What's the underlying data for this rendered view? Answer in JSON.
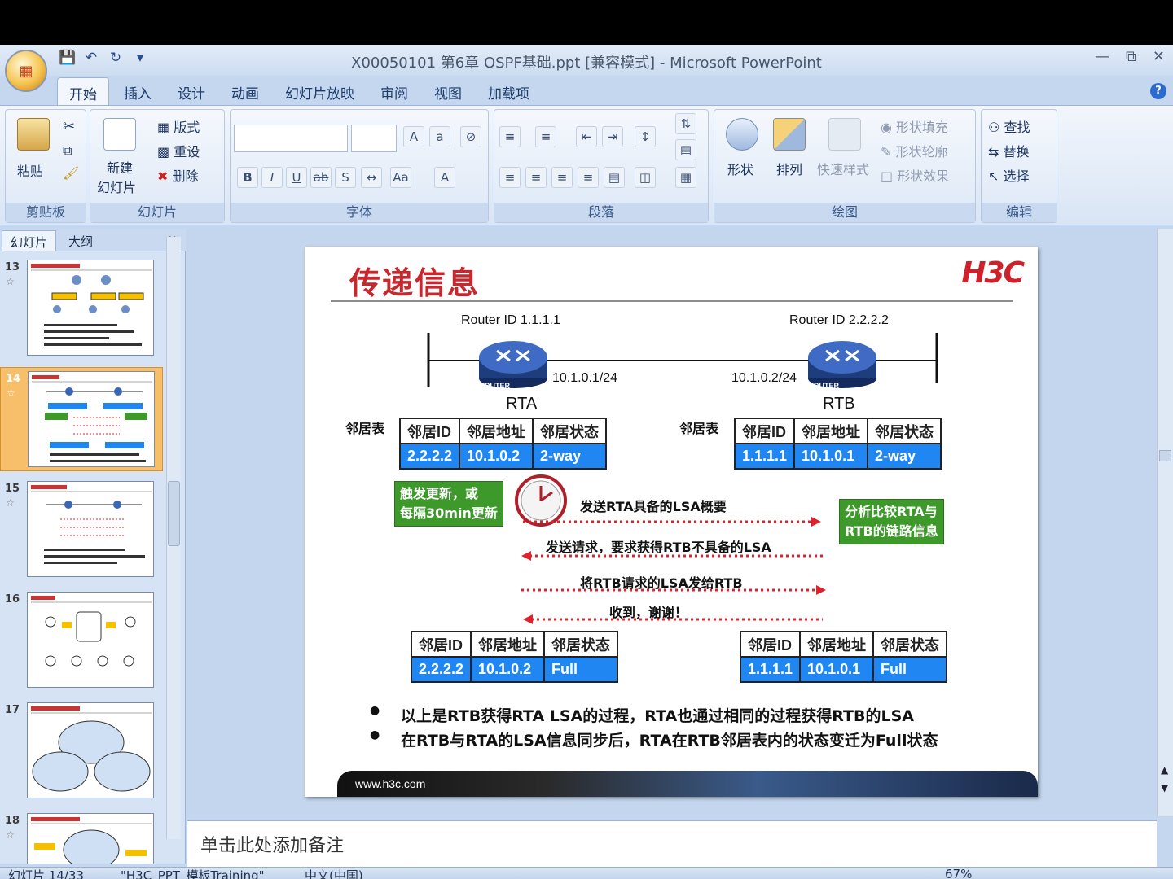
{
  "window": {
    "title": "X00050101 第6章 OSPF基础.ppt [兼容模式] - Microsoft PowerPoint"
  },
  "ribbon": {
    "tabs": [
      "开始",
      "插入",
      "设计",
      "动画",
      "幻灯片放映",
      "审阅",
      "视图",
      "加载项"
    ],
    "clipboard": {
      "paste": "粘贴",
      "label": "剪贴板"
    },
    "slides": {
      "new_slide_1": "新建",
      "new_slide_2": "幻灯片",
      "layout": "版式",
      "reset": "重设",
      "delete": "删除",
      "label": "幻灯片"
    },
    "font": {
      "label": "字体"
    },
    "paragraph": {
      "label": "段落"
    },
    "drawing": {
      "shapes": "形状",
      "arrange": "排列",
      "quick_styles": "快速样式",
      "fill": "形状填充",
      "outline": "形状轮廓",
      "effects": "形状效果",
      "label": "绘图"
    },
    "editing": {
      "find": "查找",
      "replace": "替换",
      "select": "选择",
      "label": "编辑"
    }
  },
  "left_pane": {
    "tab_slides": "幻灯片",
    "tab_outline": "大纲",
    "close": "x",
    "thumbs": [
      {
        "num": "13"
      },
      {
        "num": "14"
      },
      {
        "num": "15"
      },
      {
        "num": "16"
      },
      {
        "num": "17"
      },
      {
        "num": "18"
      }
    ]
  },
  "slide": {
    "title": "传递信息",
    "logo": "H3C",
    "rta": {
      "router_id": "Router ID 1.1.1.1",
      "ip": "10.1.0.1/24",
      "name": "RTA",
      "router_word": "ROUTER"
    },
    "rtb": {
      "router_id": "Router ID 2.2.2.2",
      "ip": "10.1.0.2/24",
      "name": "RTB",
      "router_word": "ROUTER"
    },
    "neighbor_table_label": "邻居表",
    "table_headers": [
      "邻居ID",
      "邻居地址",
      "邻居状态"
    ],
    "rta_table_1": [
      "2.2.2.2",
      "10.1.0.2",
      "2-way"
    ],
    "rtb_table_1": [
      "1.1.1.1",
      "10.1.0.1",
      "2-way"
    ],
    "rta_table_2": [
      "2.2.2.2",
      "10.1.0.2",
      "Full"
    ],
    "rtb_table_2": [
      "1.1.1.1",
      "10.1.0.1",
      "Full"
    ],
    "trigger_1": "触发更新，或",
    "trigger_2": "每隔30min更新",
    "analyze_1": "分析比较RTA与",
    "analyze_2": "RTB的链路信息",
    "msg_1": "发送RTA具备的LSA概要",
    "msg_2": "发送请求，要求获得RTB不具备的LSA",
    "msg_3": "将RTB请求的LSA发给RTB",
    "msg_4": "收到，谢谢！",
    "bullet_1": "以上是RTB获得RTA LSA的过程，RTA也通过相同的过程获得RTB的LSA",
    "bullet_2": "在RTB与RTA的LSA信息同步后，RTA在RTB邻居表内的状态变迁为Full状态",
    "footer": "www.h3c.com"
  },
  "notes": {
    "placeholder": "单击此处添加备注"
  },
  "status": {
    "slide": "幻灯片 14/33",
    "theme": "\"H3C_PPT_模板Training\"",
    "lang": "中文(中国)",
    "zoom": "67%"
  },
  "colors": {
    "accent_red": "#c8272d",
    "table_blue": "#1f86f2",
    "green": "#3d9a2a",
    "arrow_red": "#e0202a"
  }
}
